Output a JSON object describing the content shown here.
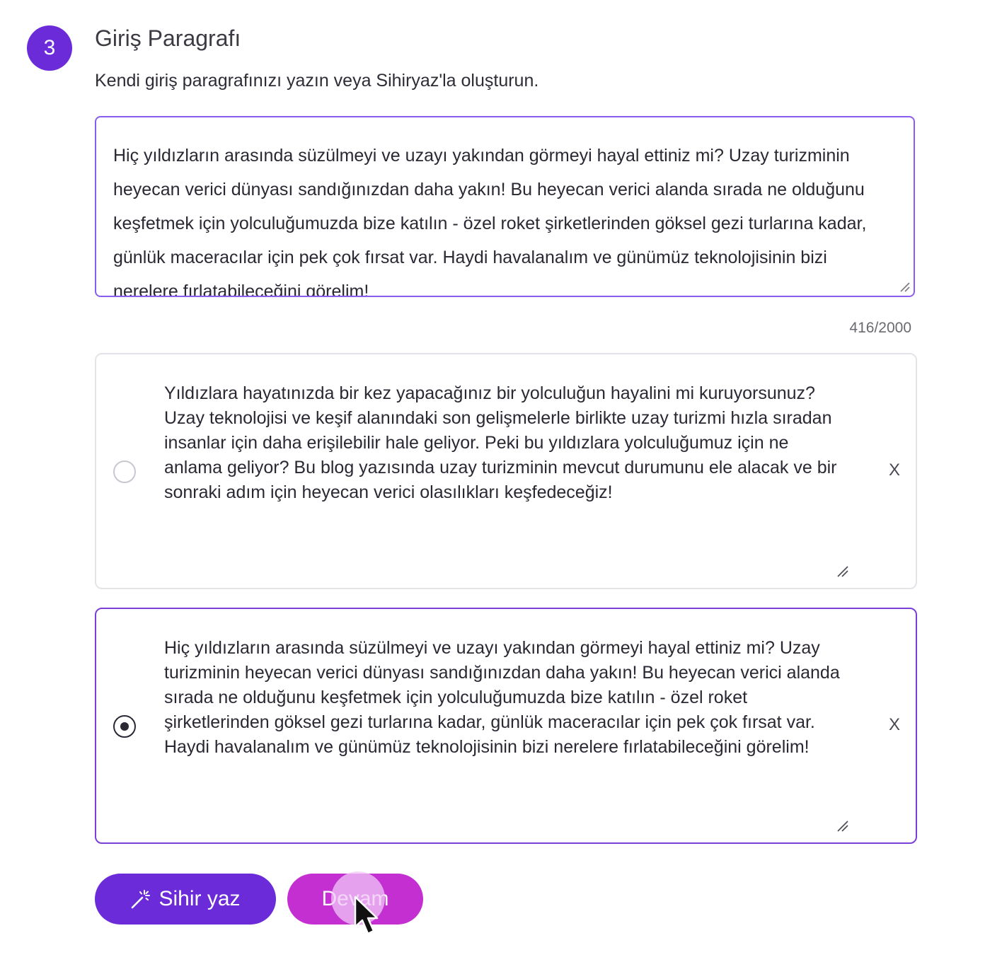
{
  "step": {
    "number": "3",
    "title": "Giriş Paragrafı",
    "subtitle": "Kendi giriş paragrafınızı yazın veya Sihiryaz'la oluşturun."
  },
  "editor": {
    "value": "Hiç yıldızların arasında süzülmeyi ve uzayı yakından görmeyi hayal ettiniz mi? Uzay turizminin heyecan verici dünyası sandığınızdan daha yakın! Bu heyecan verici alanda sırada ne olduğunu keşfetmek için yolculuğumuzda bize katılın - özel roket şirketlerinden göksel gezi turlarına kadar, günlük maceracılar için pek çok fırsat var. Haydi havalanalım ve günümüz teknolojisinin bizi nerelere fırlatabileceğini görelim!",
    "counter": "416/2000"
  },
  "options": [
    {
      "text": "Yıldızlara hayatınızda bir kez yapacağınız bir yolculuğun hayalini mi kuruyorsunuz? Uzay teknolojisi ve keşif alanındaki son gelişmelerle birlikte uzay turizmi hızla sıradan insanlar için daha erişilebilir hale geliyor. Peki bu yıldızlara yolculuğumuz için ne anlama geliyor? Bu blog yazısında uzay turizminin mevcut durumunu ele alacak ve bir sonraki adım için heyecan verici olasılıkları keşfedeceğiz!",
      "selected": false,
      "close_label": "X"
    },
    {
      "text": "Hiç yıldızların arasında süzülmeyi ve uzayı yakından görmeyi hayal ettiniz mi? Uzay turizminin heyecan verici dünyası sandığınızdan daha yakın! Bu heyecan verici alanda sırada ne olduğunu keşfetmek için yolculuğumuzda bize katılın - özel roket şirketlerinden göksel gezi turlarına kadar, günlük maceracılar için pek çok fırsat var. Haydi havalanalım ve günümüz teknolojisinin bizi nerelere fırlatabileceğini görelim!",
      "selected": true,
      "close_label": "X"
    }
  ],
  "buttons": {
    "magic_label": "Sihir yaz",
    "continue_label": "Devam"
  },
  "colors": {
    "primary": "#6c2bd9",
    "continue": "#c42fd1",
    "focus_border": "#8a5cf0"
  },
  "icons": {
    "magic": "magic-wand-icon",
    "close": "close-icon",
    "resize": "resize-grip-icon",
    "cursor": "mouse-pointer-icon"
  }
}
